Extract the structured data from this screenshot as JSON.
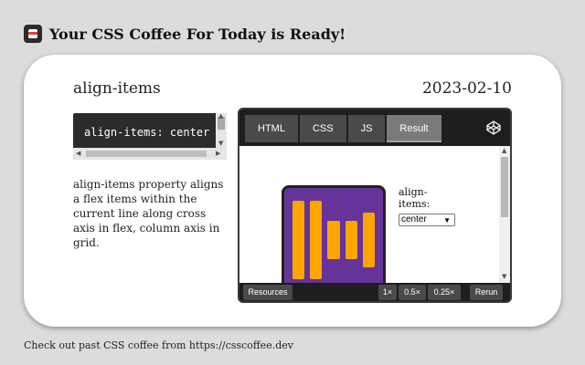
{
  "header": {
    "title": "Your CSS Coffee For Today is Ready!"
  },
  "card": {
    "property_name": "align-items",
    "date": "2023-02-10",
    "code": "align-items: center",
    "description": "align-items property aligns a flex items within the current line along cross axis in flex, column axis in grid."
  },
  "embed": {
    "tabs": [
      "HTML",
      "CSS",
      "JS",
      "Result"
    ],
    "active_tab": "Result",
    "result": {
      "control_label": "align-items:",
      "select_value": "center",
      "bar_heights_percent": [
        75,
        75,
        37,
        37,
        53
      ],
      "colors": {
        "container": "#663399",
        "items": "#ffa500"
      }
    },
    "bottom": {
      "resources_label": "Resources",
      "zoom_options": [
        "1×",
        "0.5×",
        "0.25×"
      ],
      "rerun_label": "Rerun"
    }
  },
  "footer": {
    "text": "Check out past CSS coffee from https://csscoffee.dev"
  },
  "colors": {
    "background": "#dcdcdc",
    "card": "#ffffff",
    "code_bg": "#2b2b2b",
    "accent_red": "#e0443c"
  }
}
